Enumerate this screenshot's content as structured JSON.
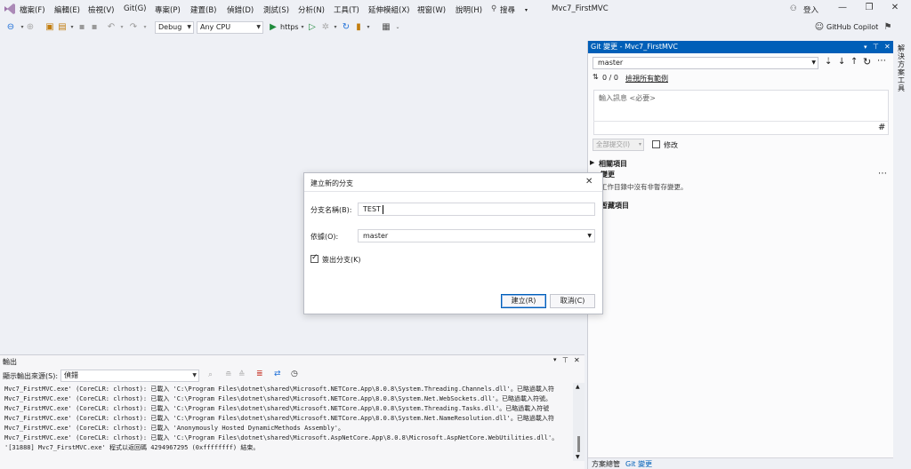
{
  "menubar": {
    "items": [
      "檔案(F)",
      "編輯(E)",
      "檢視(V)",
      "Git(G)",
      "專案(P)",
      "建置(B)",
      "偵錯(D)",
      "測試(S)",
      "分析(N)",
      "工具(T)",
      "延伸模組(X)",
      "視窗(W)",
      "說明(H)"
    ],
    "search_label": "搜尋",
    "solution_name": "Mvc7_FirstMVC",
    "signin_label": "登入",
    "copilot_label": "GitHub Copilot"
  },
  "toolbar": {
    "config": "Debug",
    "platform": "Any CPU",
    "run_target": "https"
  },
  "git_panel": {
    "title": "Git 變更 - Mvc7_FirstMVC",
    "branch": "master",
    "sync_counts": "0 / 0",
    "view_all_repos": "檢視所有範例",
    "message_placeholder": "輸入訊息 <必要>",
    "commit_all_label": "全部提交(I)",
    "amend_label": "修改",
    "related_items_label": "相關項目",
    "changes_label": "變更",
    "changes_status": "工作目錄中沒有非暫存變更。",
    "staged_items_label": "暫藏項目",
    "bottom_tabs": [
      "方案總管",
      "Git 變更"
    ]
  },
  "right_strip": {
    "label": "解決方案工具"
  },
  "dialog": {
    "title": "建立新的分支",
    "branch_name_label": "分支名稱(B):",
    "branch_name_value": "TEST",
    "based_on_label": "依據(O):",
    "based_on_value": "master",
    "checkout_label": "簽出分支(K)",
    "checkout_checked": true,
    "create_button": "建立(R)",
    "cancel_button": "取消(C)"
  },
  "output": {
    "title": "輸出",
    "source_label": "顯示輸出來源(S):",
    "source_value": "偵錯",
    "lines": [
      "Mvc7_FirstMVC.exe' (CoreCLR: clrhost): 已載入 'C:\\Program Files\\dotnet\\shared\\Microsoft.NETCore.App\\8.0.8\\System.Threading.Channels.dll'。已略過載入符",
      "Mvc7_FirstMVC.exe' (CoreCLR: clrhost): 已載入 'C:\\Program Files\\dotnet\\shared\\Microsoft.NETCore.App\\8.0.8\\System.Net.WebSockets.dll'。已略過載入符號。",
      "Mvc7_FirstMVC.exe' (CoreCLR: clrhost): 已載入 'C:\\Program Files\\dotnet\\shared\\Microsoft.NETCore.App\\8.0.8\\System.Threading.Tasks.dll'。已略過載入符號",
      "Mvc7_FirstMVC.exe' (CoreCLR: clrhost): 已載入 'C:\\Program Files\\dotnet\\shared\\Microsoft.NETCore.App\\8.0.8\\System.Net.NameResolution.dll'。已略過載入符",
      "Mvc7_FirstMVC.exe' (CoreCLR: clrhost): 已載入 'Anonymously Hosted DynamicMethods Assembly'。",
      "Mvc7_FirstMVC.exe' (CoreCLR: clrhost): 已載入 'C:\\Program Files\\dotnet\\shared\\Microsoft.AspNetCore.App\\8.0.8\\Microsoft.AspNetCore.WebUtilities.dll'。",
      "'[31888] Mvc7_FirstMVC.exe' 程式以返回碼 4294967295 (0xffffffff) 結束。"
    ]
  }
}
